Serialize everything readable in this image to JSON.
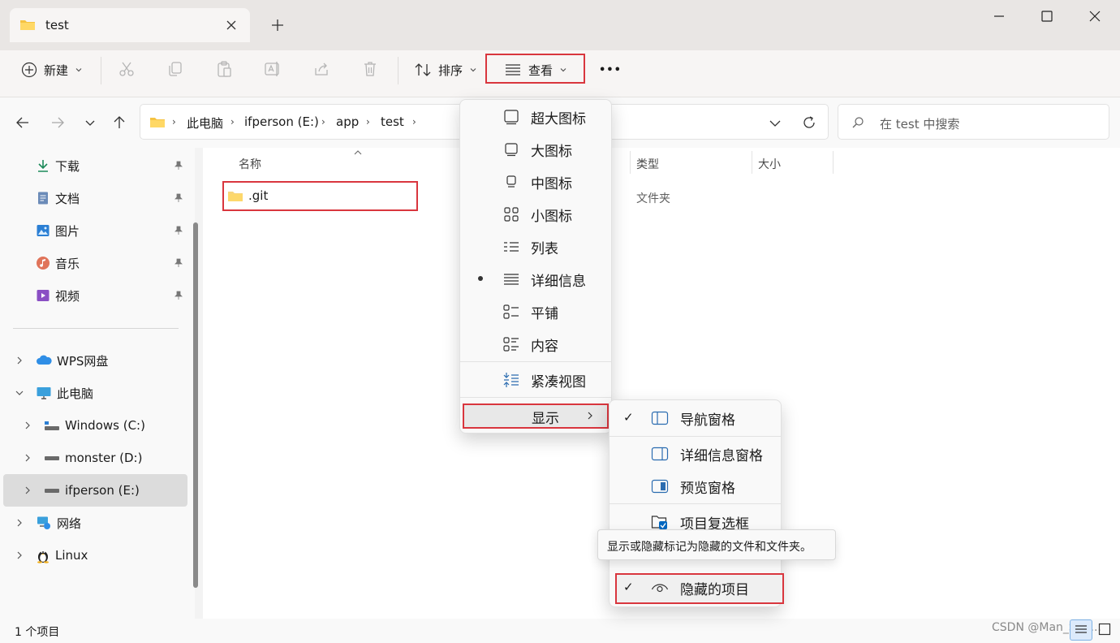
{
  "window": {
    "tab_title": "test",
    "new_tab_label": "+"
  },
  "toolbar": {
    "new_label": "新建",
    "sort_label": "排序",
    "view_label": "查看",
    "more_label": "•••"
  },
  "nav": {
    "breadcrumbs": [
      "此电脑",
      "ifperson (E:)",
      "app",
      "test"
    ],
    "search_placeholder": "在 test 中搜索"
  },
  "sidebar": {
    "quick_access": [
      {
        "label": "下载",
        "icon": "download-icon"
      },
      {
        "label": "文档",
        "icon": "document-icon"
      },
      {
        "label": "图片",
        "icon": "picture-icon"
      },
      {
        "label": "音乐",
        "icon": "music-icon"
      },
      {
        "label": "视频",
        "icon": "video-icon"
      }
    ],
    "tree": [
      {
        "label": "WPS网盘",
        "icon": "cloud-icon"
      },
      {
        "label": "此电脑",
        "icon": "computer-icon"
      },
      {
        "label": "Windows (C:)",
        "icon": "drive-icon"
      },
      {
        "label": "monster (D:)",
        "icon": "drive-icon"
      },
      {
        "label": "ifperson (E:)",
        "icon": "drive-icon"
      },
      {
        "label": "网络",
        "icon": "network-icon"
      },
      {
        "label": "Linux",
        "icon": "linux-icon"
      }
    ]
  },
  "file_list": {
    "columns": [
      "名称",
      "类型",
      "大小"
    ],
    "rows": [
      {
        "name": ".git",
        "type": "文件夹"
      }
    ]
  },
  "view_menu": {
    "items": [
      "超大图标",
      "大图标",
      "中图标",
      "小图标",
      "列表",
      "详细信息",
      "平铺",
      "内容",
      "紧凑视图",
      "显示"
    ]
  },
  "show_menu": {
    "items": [
      "导航窗格",
      "详细信息窗格",
      "预览窗格",
      "项目复选框",
      "隐藏的项目"
    ]
  },
  "tooltip": "显示或隐藏标记为隐藏的文件和文件夹。",
  "status": {
    "count": "1 个项目"
  },
  "watermark": "CSDN @Man_Sun...",
  "colors": {
    "highlight_border": "#d9363e",
    "folder": "#f5c342",
    "accent": "#0067c0"
  }
}
